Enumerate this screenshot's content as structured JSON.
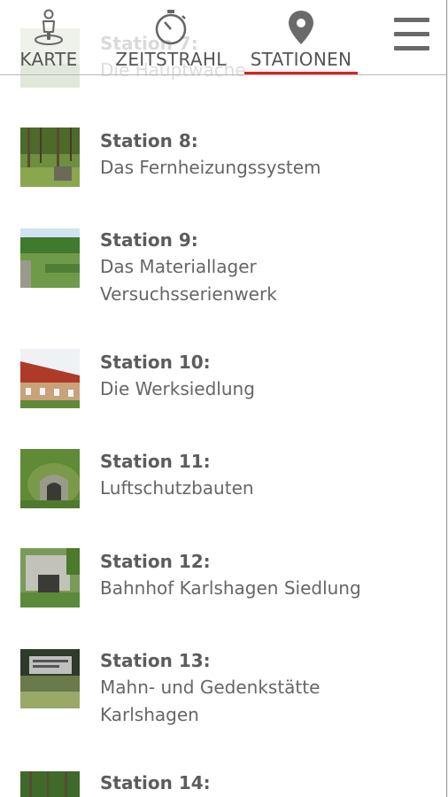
{
  "nav": {
    "tabs": [
      {
        "label": "KARTE",
        "icon": "person-on-map-icon",
        "active": false
      },
      {
        "label": "ZEITSTRAHL",
        "icon": "stopwatch-icon",
        "active": false
      },
      {
        "label": "STATIONEN",
        "icon": "map-pin-icon",
        "active": true
      }
    ],
    "menu_icon": "hamburger-menu-icon",
    "accent_color": "#e02020"
  },
  "stations": [
    {
      "title": "Station 7:",
      "lines": [
        "Die Hauptwache"
      ]
    },
    {
      "title": "Station 8:",
      "lines": [
        "Das Fernheizungssystem"
      ]
    },
    {
      "title": "Station 9:",
      "lines": [
        "Das Materiallager",
        "Versuchsserienwerk"
      ]
    },
    {
      "title": "Station 10:",
      "lines": [
        "Die Werksiedlung"
      ]
    },
    {
      "title": "Station 11:",
      "lines": [
        "Luftschutzbauten"
      ]
    },
    {
      "title": "Station 12:",
      "lines": [
        "Bahnhof Karlshagen Siedlung"
      ]
    },
    {
      "title": "Station 13:",
      "lines": [
        "Mahn- und Gedenkstätte",
        "Karlshagen"
      ]
    },
    {
      "title": "Station 14:",
      "lines": []
    }
  ]
}
